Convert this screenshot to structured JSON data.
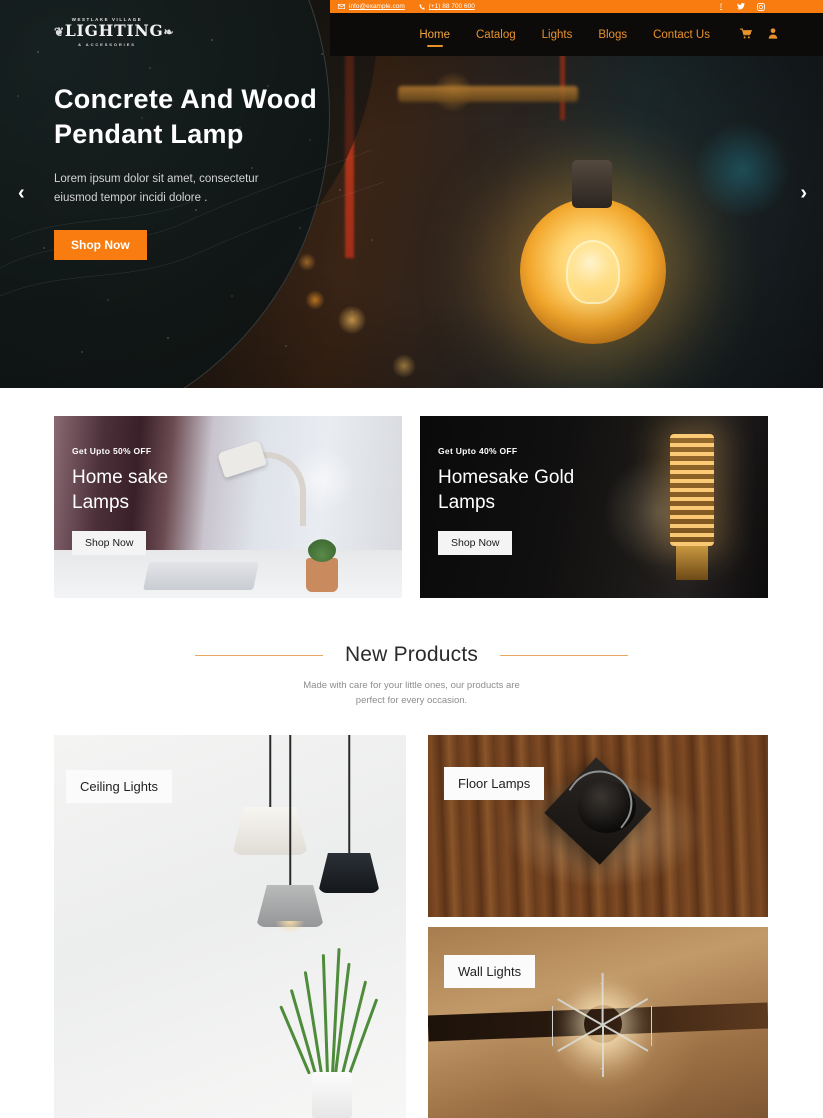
{
  "topbar": {
    "email": "info@example.com",
    "phone": "(+1) 88 700 600",
    "email_icon": "envelope-icon",
    "phone_icon": "phone-icon",
    "social": [
      {
        "name": "facebook-icon",
        "glyph": "f"
      },
      {
        "name": "twitter-icon",
        "glyph": "✕"
      },
      {
        "name": "instagram-icon",
        "glyph": "◎"
      }
    ],
    "accent_color": "#f97c10"
  },
  "logo": {
    "top_line": "WESTLAKE VILLAGE",
    "main": "LIGHTING",
    "bottom_line": "& ACCESSORIES",
    "ornament_left": "❦",
    "ornament_right": "❧"
  },
  "nav": {
    "items": [
      {
        "label": "Home",
        "active": true
      },
      {
        "label": "Catalog",
        "active": false
      },
      {
        "label": "Lights",
        "active": false
      },
      {
        "label": "Blogs",
        "active": false
      },
      {
        "label": "Contact Us",
        "active": false
      }
    ],
    "cart_icon": "shopping-cart-icon",
    "account_icon": "user-account-icon",
    "link_color": "#e8922c",
    "bg_color": "#0d0b0a"
  },
  "hero": {
    "title_line1": "Concrete And Wood",
    "title_line2": "Pendant Lamp",
    "subtitle_line1": "Lorem ipsum dolor sit amet, consectetur",
    "subtitle_line2": "eiusmod tempor incidi dolore .",
    "cta_label": "Shop Now",
    "prev_icon": "chevron-left-icon",
    "next_icon": "chevron-right-icon",
    "prev_glyph": "‹",
    "next_glyph": "›"
  },
  "promos": [
    {
      "offer": "Get Upto 50% OFF",
      "title_line1": "Home sake",
      "title_line2": "Lamps",
      "cta_label": "Shop Now"
    },
    {
      "offer": "Get Upto 40% OFF",
      "title_line1": "Homesake Gold",
      "title_line2": "Lamps",
      "cta_label": "Shop Now"
    }
  ],
  "section": {
    "title": "New Products",
    "subtitle_line1": "Made with care for your little ones, our products are",
    "subtitle_line2": "perfect for every occasion.",
    "rule_color": "#e8a766"
  },
  "products": [
    {
      "label": "Ceiling Lights"
    },
    {
      "label": "Floor Lamps"
    },
    {
      "label": "Wall Lights"
    }
  ]
}
